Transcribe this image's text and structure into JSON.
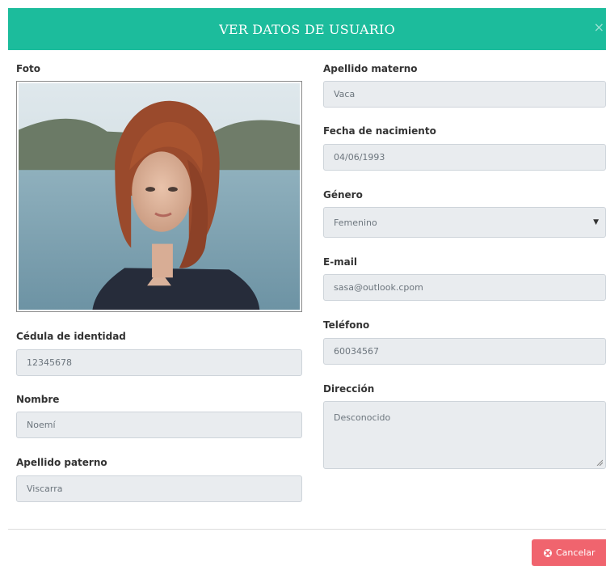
{
  "modal": {
    "title": "VER DATOS DE USUARIO",
    "close": "×"
  },
  "fields": {
    "foto_label": "Foto",
    "cedula": {
      "label": "Cédula de identidad",
      "value": "12345678"
    },
    "nombre": {
      "label": "Nombre",
      "value": "Noemí"
    },
    "apellido_paterno": {
      "label": "Apellido paterno",
      "value": "Viscarra"
    },
    "apellido_materno": {
      "label": "Apellido materno",
      "value": "Vaca"
    },
    "fecha_nacimiento": {
      "label": "Fecha de nacimiento",
      "value": "04/06/1993"
    },
    "genero": {
      "label": "Género",
      "value": "Femenino"
    },
    "email": {
      "label": "E-mail",
      "value": "sasa@outlook.cpom"
    },
    "telefono": {
      "label": "Teléfono",
      "value": "60034567"
    },
    "direccion": {
      "label": "Dirección",
      "value": "Desconocido"
    }
  },
  "footer": {
    "cancel_label": "Cancelar"
  },
  "colors": {
    "header": "#1cbc9c",
    "cancel": "#f0646e",
    "field_bg": "#e9ecef"
  }
}
